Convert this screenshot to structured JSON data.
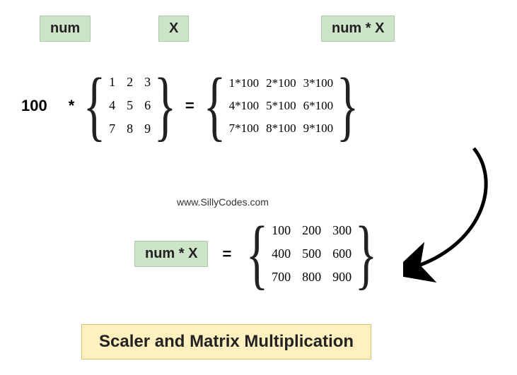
{
  "labels": {
    "num": "num",
    "x": "X",
    "numx": "num * X"
  },
  "scalar": "100",
  "op_mul": "*",
  "op_eq": "=",
  "matrix_X": {
    "r0c0": "1",
    "r0c1": "2",
    "r0c2": "3",
    "r1c0": "4",
    "r1c1": "5",
    "r1c2": "6",
    "r2c0": "7",
    "r2c1": "8",
    "r2c2": "9"
  },
  "matrix_expand": {
    "r0c0": "1*100",
    "r0c1": "2*100",
    "r0c2": "3*100",
    "r1c0": "4*100",
    "r1c1": "5*100",
    "r1c2": "6*100",
    "r2c0": "7*100",
    "r2c1": "8*100",
    "r2c2": "9*100"
  },
  "matrix_result": {
    "r0c0": "100",
    "r0c1": "200",
    "r0c2": "300",
    "r1c0": "400",
    "r1c1": "500",
    "r1c2": "600",
    "r2c0": "700",
    "r2c1": "800",
    "r2c2": "900"
  },
  "website": "www.SillyCodes.com",
  "title": "Scaler and Matrix Multiplication"
}
